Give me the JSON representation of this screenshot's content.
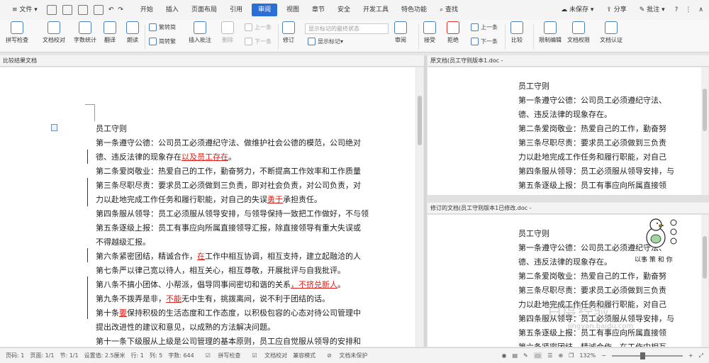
{
  "menu": {
    "file": "文件",
    "tabs": [
      "开始",
      "插入",
      "页面布局",
      "引用",
      "审阅",
      "视图",
      "章节",
      "安全",
      "开发工具",
      "特色功能"
    ],
    "search": "查找",
    "unsaved": "未保存",
    "share": "分享",
    "comment": "批注"
  },
  "ribbon": {
    "spell": "拼写检查",
    "proof": "文档校对",
    "wordcount": "字数统计",
    "translate": "翻译",
    "read": "朗读",
    "trad": "繁转简",
    "simp": "简转繁",
    "insert_comment": "插入批注",
    "delete": "删除",
    "prev": "上一条",
    "next": "下一条",
    "revise": "修订",
    "markup_combo": "显示标记的最终状态",
    "show_markup": "显示标记",
    "review": "审阅",
    "accept": "接受",
    "reject": "拒绝",
    "prev2": "上一条",
    "next2": "下一条",
    "compare": "比较",
    "restrict": "限制编辑",
    "permission": "文档权限",
    "certify": "文档认证"
  },
  "panes": {
    "left_title": "比较结果文档",
    "right_top_title": "原文档(员工守则版本1.doc -",
    "right_bottom_title": "修订的文档(员工守则版本1已修改.doc -"
  },
  "left_doc": {
    "title": "员工守则",
    "l1": "第一条遵守公德：公司员工必须遵纪守法、做维护社会公德的模范，公司绝对",
    "l2a": "德、违反法律的现象存在",
    "l2b": "以及员工存在",
    "l2c": "。",
    "l3": "第二条爱岗敬业：热爱自己的工作，勤奋努力，不断提高工作效率和工作质量",
    "l4": "第三条尽职尽责：要求员工必须做到三负责，即对社会负责，对公司负责，对",
    "l5a": "力以赴地完成工作任务和履行职能，对自己的失误",
    "l5b": "勇于",
    "l5c": "承担责任。",
    "l6": "第四条服从领导：员工必须服从领导安排，与领导保持一致把工作做好，不与领",
    "l7": "第五条逐级上报：员工有事应向所属直接领导汇报，除直接领导有重大失误或",
    "l8": "不得越级汇报。",
    "l9a": "第六条紧密团结，精诚合作，",
    "l9b": "在",
    "l9c": "工作中相互协调，相互支持，建立起融洽的人",
    "l10": "第七条严以律己宽以待人，相互关心，相互尊敬，开展批评与自我批评。",
    "l11a": "第八条不搞小团体、小帮派，倡导同事间密切和谐的关系",
    "l11b": "，不挤兑新人",
    "l11c": "。",
    "l12a": "第九条不拨弄是非，",
    "l12b": "不能",
    "l12c": "无中生有，挑拨离间，说不利于团结的话。",
    "l13a": "第十条",
    "l13b": "要",
    "l13c": "保持积极的生活态度和工作态度，以积极包容的心态对待公司管理中",
    "l14": "提出改进性的建议和意见，以成熟的方法解决问题。",
    "l15": "第十一条下级服从上级是公司管理的基本原则，员工应自觉服从领导的安排和"
  },
  "right_top_doc": {
    "title": "员工守则",
    "l1": "第一条遵守公德：公司员工必须遵纪守法、",
    "l2": "德、违反法律的现象存在。",
    "l3": "第二条爱岗敬业：热爱自己的工作，勤奋努",
    "l4": "第三条尽职尽责：要求员工必须做到三负责",
    "l5": "力以赴地完成工作任务和履行职能，对自己",
    "l6": "第四条服从领导：员工必须服从领导安排，与",
    "l7": "第五条逐级上报：员工有事应向所属直接领"
  },
  "right_bottom_doc": {
    "title": "员工守则",
    "l1": "第一条遵守公德：公司员工必须遵纪守法、",
    "l2": "德、违反法律的现象存在。",
    "l3": "第二条爱岗敬业：热爱自己的工作，勤奋努",
    "l4": "第三条尽职尽责：要求员工必须做到三负责",
    "l5": "力以赴地完成工作任务和履行职能，对自己",
    "l6": "第四条服从领导：员工必须服从领导安排，与",
    "l7": "第五条逐级上报：员工有事应向所属直接领",
    "l8": "第六条紧密团结，精诚合作，在工作中相互"
  },
  "status": {
    "page": "页码: 1",
    "pages": "页面: 1/1",
    "section": "节: 1/1",
    "setting": "设置值: 2.5厘米",
    "row": "行: 1",
    "col": "列: 5",
    "words": "字数: 644",
    "spell": "拼写检查",
    "proof": "文档校对",
    "compat": "兼容模式",
    "protect": "文档未保护",
    "zoom": "132%"
  },
  "watermark": {
    "text": "百度经验",
    "url": "jingyan.baidu.com",
    "sticker": "以事 策 和 你"
  },
  "accent_color": "#2b6fd6",
  "revision_color": "#e0201a"
}
